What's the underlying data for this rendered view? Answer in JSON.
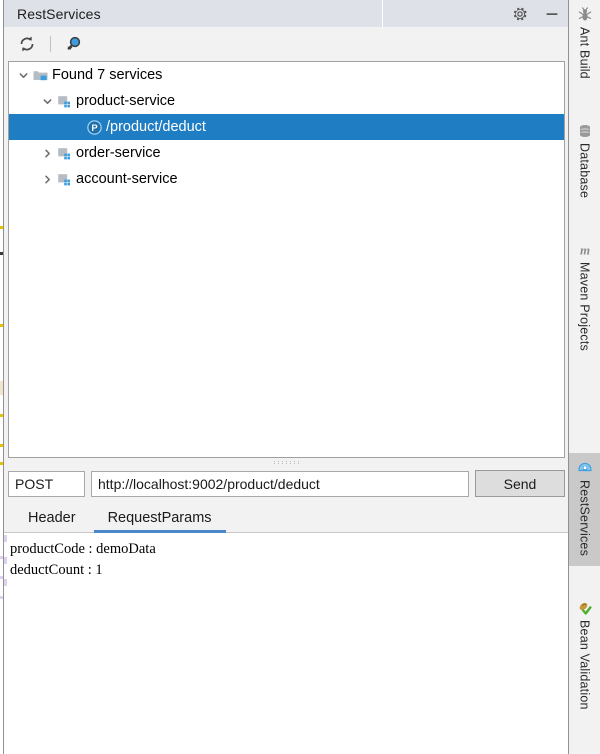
{
  "window": {
    "title": "RestServices",
    "settings_icon": "gear-icon",
    "minimize_icon": "minimize-icon"
  },
  "toolbar": {
    "refresh_label": "Refresh",
    "refresh_icon": "refresh-icon",
    "search_label": "Search",
    "search_icon": "search-dropdown-icon"
  },
  "tree": {
    "nodes": [
      {
        "label": "Found 7 services",
        "icon": "folder-icon",
        "twisty": "chevron-down-icon",
        "expanded": true,
        "depth": 0,
        "selected": false
      },
      {
        "label": "product-service",
        "icon": "module-icon",
        "twisty": "chevron-down-icon",
        "expanded": true,
        "depth": 1,
        "selected": false
      },
      {
        "label": "/product/deduct",
        "icon": "post-method-icon",
        "icon_letter": "P",
        "twisty": "",
        "expanded": false,
        "depth": 2,
        "selected": true
      },
      {
        "label": "order-service",
        "icon": "module-icon",
        "twisty": "chevron-right-icon",
        "expanded": false,
        "depth": 1,
        "selected": false
      },
      {
        "label": "account-service",
        "icon": "module-icon",
        "twisty": "chevron-right-icon",
        "expanded": false,
        "depth": 1,
        "selected": false
      }
    ]
  },
  "request": {
    "method": "POST",
    "method_placeholder": "Method",
    "url": "http://localhost:9002/product/deduct",
    "url_placeholder": "URL",
    "send_label": "Send"
  },
  "tabs": [
    {
      "label": "Header",
      "active": false
    },
    {
      "label": "RequestParams",
      "active": true
    }
  ],
  "params": {
    "text": "productCode : demoData\ndeductCount : 1"
  },
  "sidebar": {
    "items": [
      {
        "label": "Ant Build",
        "icon": "ant-icon",
        "active": false
      },
      {
        "label": "Database",
        "icon": "database-icon",
        "active": false
      },
      {
        "label": "Maven Projects",
        "icon": "maven-icon",
        "active": false
      },
      {
        "label": "RestServices",
        "icon": "restservices-icon",
        "active": true
      },
      {
        "label": "Bean Validation",
        "icon": "bean-validation-icon",
        "active": false
      }
    ]
  },
  "colors": {
    "title_bar": "#dee1e8",
    "selection": "#1f7dc4",
    "tab_underline": "#4a88c7",
    "panel": "#f2f2f2",
    "active_sidebar": "#c9c9c9"
  }
}
